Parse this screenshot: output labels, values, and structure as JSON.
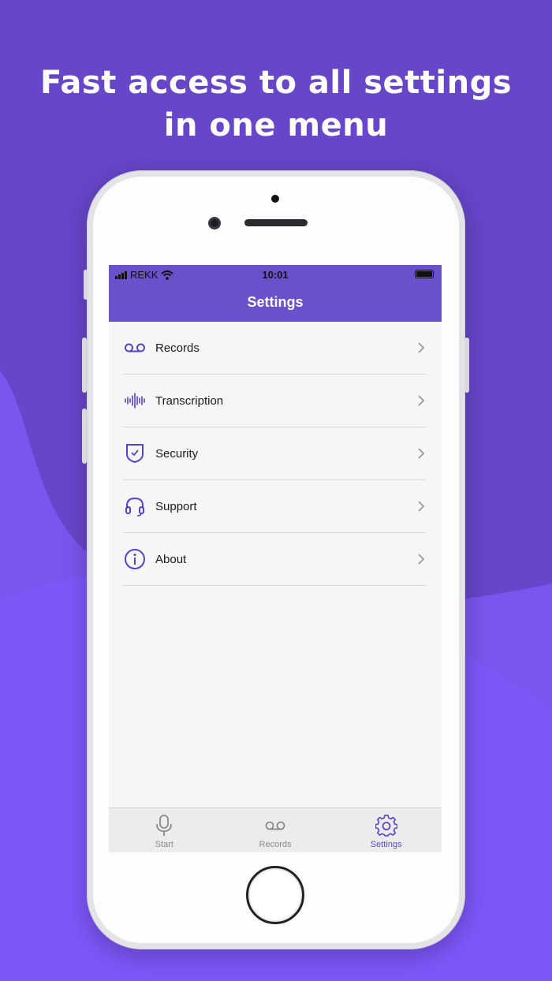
{
  "headline": {
    "line1": "Fast access to all settings",
    "line2": "in one menu"
  },
  "status_bar": {
    "carrier": "REKK",
    "time": "10:01"
  },
  "nav": {
    "title": "Settings"
  },
  "menu": {
    "items": [
      {
        "label": "Records",
        "icon": "voicemail-icon"
      },
      {
        "label": "Transcription",
        "icon": "waveform-icon"
      },
      {
        "label": "Security",
        "icon": "shield-icon"
      },
      {
        "label": "Support",
        "icon": "headphones-icon"
      },
      {
        "label": "About",
        "icon": "info-icon"
      }
    ]
  },
  "tab_bar": {
    "tabs": [
      {
        "label": "Start",
        "icon": "microphone-icon",
        "active": false
      },
      {
        "label": "Records",
        "icon": "voicemail-icon",
        "active": false
      },
      {
        "label": "Settings",
        "icon": "gear-icon",
        "active": true
      }
    ]
  },
  "colors": {
    "background": "#6746c9",
    "accent": "#6a51cc",
    "icon": "#5b43c0",
    "active_tab": "#6247c6"
  }
}
